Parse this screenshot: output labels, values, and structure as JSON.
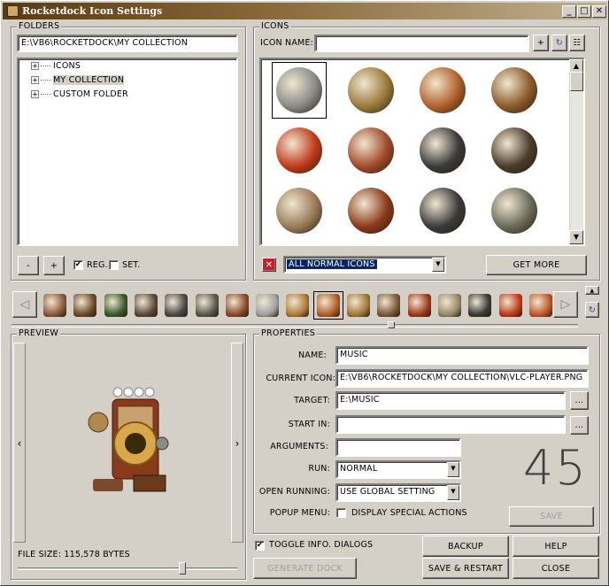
{
  "window": {
    "title": "Rocketdock Icon Settings",
    "min": "_",
    "max": "□",
    "close": "✕"
  },
  "folders": {
    "label": "FOLDERS",
    "path": "E:\\VB6\\ROCKETDOCK\\MY COLLECTION",
    "tree": [
      {
        "label": "ICONS",
        "selected": false
      },
      {
        "label": "MY COLLECTION",
        "selected": true
      },
      {
        "label": "CUSTOM FOLDER",
        "selected": false
      }
    ],
    "minus_label": "-",
    "plus_label": "+",
    "reg_label": "REG.",
    "reg_checked": true,
    "set_label": "SET.",
    "set_checked": false
  },
  "icons": {
    "label": "ICONS",
    "name_label": "ICON NAME:",
    "name_value": "",
    "add_label": "+",
    "filter_value": "ALL NORMAL ICONS",
    "get_more_label": "GET MORE",
    "grid": [
      {
        "name": "gear-clock-icon",
        "color": "#8a8a86",
        "selected": true
      },
      {
        "name": "syringe-icon",
        "color": "#9a7a3a"
      },
      {
        "name": "metronome-icon",
        "color": "#b0602a"
      },
      {
        "name": "globe-stand-icon",
        "color": "#8a5a2a"
      },
      {
        "name": "crystal-eye-icon",
        "color": "#c03a1a"
      },
      {
        "name": "bulb-sphere-icon",
        "color": "#a04a2a"
      },
      {
        "name": "typewriter-lamp-icon",
        "color": "#3a3a3a"
      },
      {
        "name": "typewriter-icon",
        "color": "#4a3a2a"
      },
      {
        "name": "radio-bulb-icon",
        "color": "#9a7a5a"
      },
      {
        "name": "organ-icon",
        "color": "#8a3a1a"
      },
      {
        "name": "postage-stamp-icon",
        "color": "#3a3a3a"
      },
      {
        "name": "postage-magnifier-icon",
        "color": "#6a6a5a"
      }
    ]
  },
  "dock": {
    "left_label": "◁",
    "right_label": "▷",
    "items": [
      {
        "name": "dock-item-1",
        "color": "#8a5a3a"
      },
      {
        "name": "dock-item-2",
        "color": "#6a4a2a"
      },
      {
        "name": "dock-item-3",
        "color": "#3a5a2a"
      },
      {
        "name": "dock-item-4",
        "color": "#5a4a3a"
      },
      {
        "name": "dock-item-5",
        "color": "#4a4a4a"
      },
      {
        "name": "dock-item-6",
        "color": "#5a5a4a"
      },
      {
        "name": "dock-item-7",
        "color": "#8a4a2a"
      },
      {
        "name": "dock-item-8",
        "color": "#a0a0a0"
      },
      {
        "name": "dock-item-9",
        "color": "#b07a3a"
      },
      {
        "name": "dock-item-10",
        "color": "#b0602a"
      },
      {
        "name": "dock-item-11",
        "color": "#a07a3a"
      },
      {
        "name": "dock-item-12",
        "color": "#7a5a3a"
      },
      {
        "name": "dock-item-13",
        "color": "#a03a1a"
      },
      {
        "name": "dock-item-14",
        "color": "#9a8a6a"
      },
      {
        "name": "dock-item-15",
        "color": "#3a3a3a"
      },
      {
        "name": "dock-item-16",
        "color": "#c03a1a"
      },
      {
        "name": "dock-item-17",
        "color": "#c05a2a"
      }
    ],
    "selected_index": 9
  },
  "preview": {
    "label": "PREVIEW",
    "left_arrow": "‹",
    "right_arrow": "›",
    "file_size": "FILE SIZE: 115,578 BYTES"
  },
  "properties": {
    "label": "PROPERTIES",
    "name_label": "NAME:",
    "name_value": "MUSIC",
    "current_icon_label": "CURRENT ICON:",
    "current_icon_value": "E:\\VB6\\ROCKETDOCK\\MY COLLECTION\\VLC-PLAYER.PNG",
    "target_label": "TARGET:",
    "target_value": "E:\\MUSIC",
    "start_in_label": "START IN:",
    "start_in_value": "",
    "arguments_label": "ARGUMENTS:",
    "arguments_value": "",
    "run_label": "RUN:",
    "run_value": "NORMAL",
    "open_running_label": "OPEN RUNNING:",
    "open_running_value": "USE GLOBAL SETTING",
    "popup_label": "POPUP MENU:",
    "popup_option": "DISPLAY SPECIAL ACTIONS",
    "popup_checked": false,
    "browse_label": "...",
    "counter": "45",
    "save_label": "SAVE"
  },
  "bottom": {
    "toggle_label": "TOGGLE INFO. DIALOGS",
    "toggle_checked": true,
    "generate_label": "GENERATE DOCK",
    "backup_label": "BACKUP",
    "help_label": "HELP",
    "save_restart_label": "SAVE & RESTART",
    "close_label": "CLOSE"
  }
}
